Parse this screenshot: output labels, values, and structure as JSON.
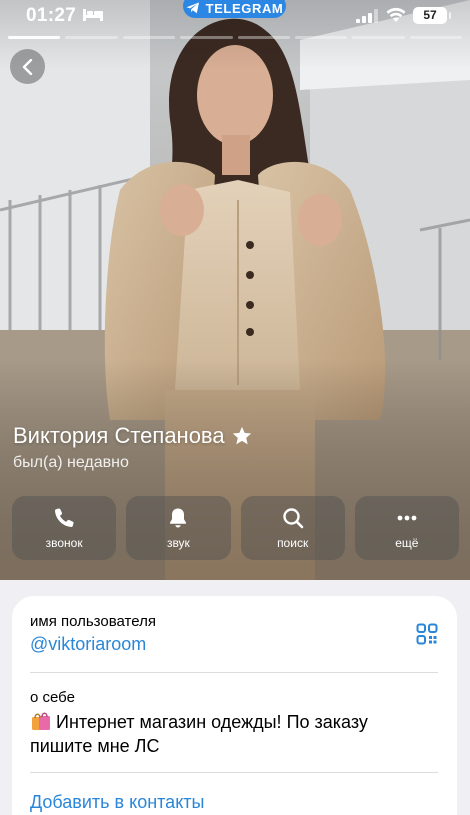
{
  "status_bar": {
    "time": "01:27",
    "battery": "57",
    "pill_label": "TELEGRAM"
  },
  "profile": {
    "name": "Виктория Степанова",
    "last_seen": "был(а) недавно"
  },
  "actions": [
    {
      "label": "звонок",
      "icon": "phone-icon"
    },
    {
      "label": "звук",
      "icon": "bell-icon"
    },
    {
      "label": "поиск",
      "icon": "search-icon"
    },
    {
      "label": "ещё",
      "icon": "more-icon"
    }
  ],
  "info": {
    "username_label": "имя пользователя",
    "username": "@viktoriaroom",
    "bio_label": "о себе",
    "bio_text": "Интернет магазин одежды! По заказу пишите мне ЛС",
    "add_contact": "Добавить в контакты"
  },
  "colors": {
    "accent": "#2a86d9",
    "telegram_pill": "#2b87e3",
    "background": "#efeff4"
  }
}
